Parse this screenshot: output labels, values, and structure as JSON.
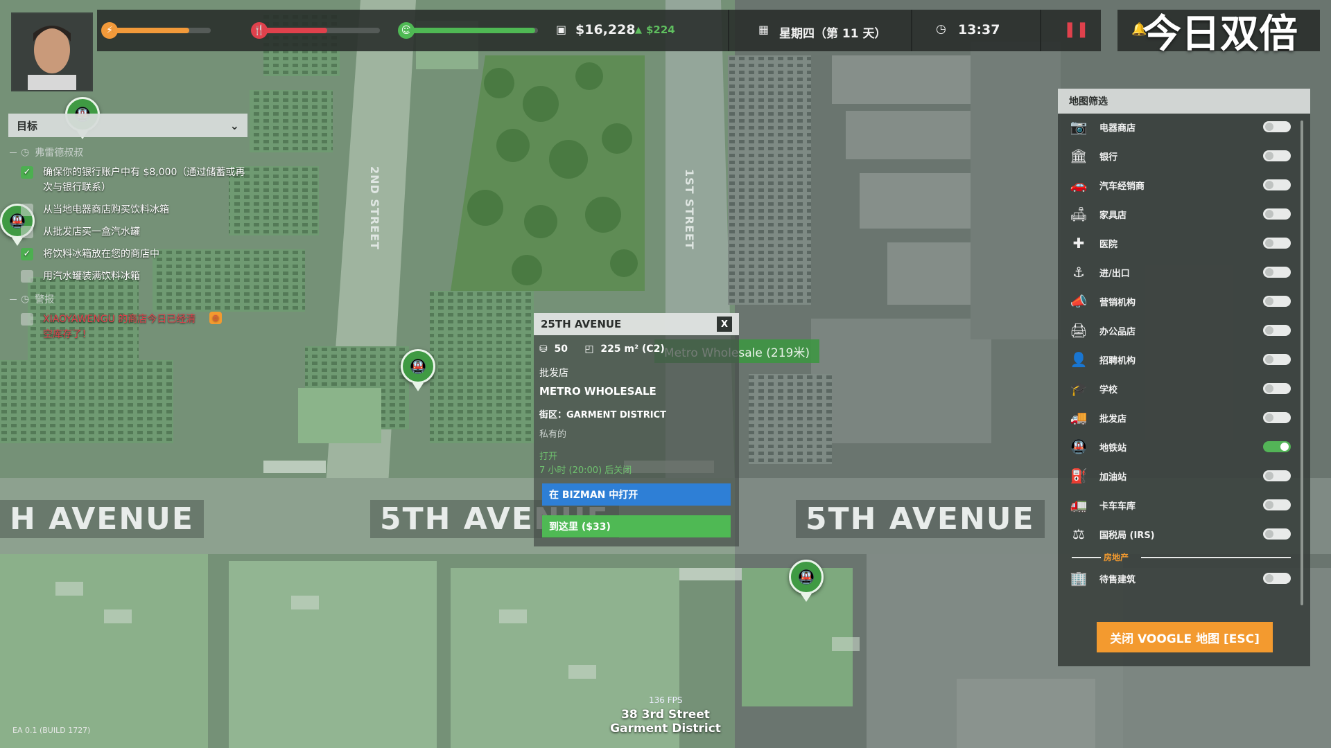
{
  "colors": {
    "energy": "#f29a3a",
    "hunger": "#e0414c",
    "happiness": "#4fb954",
    "accent_green": "#4caf50",
    "accent_blue": "#2e7fd6",
    "accent_orange": "#f39a2f",
    "alert_red": "#e0414c"
  },
  "hud": {
    "energy_level": 0.78,
    "hunger_level": 0.55,
    "happiness_level": 0.98,
    "money": "$16,228",
    "money_change": "$224",
    "day": "星期四（第 11 天）",
    "time": "13:37",
    "watermark": "今日双倍"
  },
  "goals": {
    "title": "目标",
    "sections": [
      {
        "name": "弗雷德叔叔",
        "items": [
          {
            "text": "确保你的银行账户中有 $8,000（通过储蓄或再次与银行联系）",
            "checked": true
          },
          {
            "text": "从当地电器商店购买饮料冰箱",
            "checked": false
          },
          {
            "text": "从批发店买一盒汽水罐",
            "checked": false
          },
          {
            "text": "将饮料冰箱放在您的商店中",
            "checked": true
          },
          {
            "text": "用汽水罐装满饮料冰箱",
            "checked": false
          }
        ]
      },
      {
        "name": "警报",
        "items": [
          {
            "text": "XIAOYAWENGU 的商店今日已经清空库存了！",
            "checked": false
          }
        ]
      }
    ]
  },
  "map": {
    "avenue_left": "H AVENUE",
    "avenue_mid": "5TH AVENUE",
    "avenue_right": "5TH AVENUE",
    "street_2nd": "2ND STREET",
    "street_1st": "1ST STREET"
  },
  "popup": {
    "title": "25TH AVENUE",
    "close": "X",
    "capacity": "50",
    "size": "225 m² (C2)",
    "category": "批发店",
    "name": "METRO WHOLESALE",
    "district": "街区：GARMENT DISTRICT",
    "ownership": "私有的",
    "status": "打开",
    "closing": "7 小时 (20:00) 后关闭",
    "btn_open": "在 BIZMAN 中打开",
    "btn_go": "到这里 ($33)"
  },
  "tooltip": "Metro Wholesale (219米)",
  "filter": {
    "title": "地图筛选",
    "items": [
      {
        "label": "电器商店",
        "icon": "appliance-store-icon",
        "glyph": "📷",
        "on": false
      },
      {
        "label": "银行",
        "icon": "bank-icon",
        "glyph": "🏛",
        "on": false
      },
      {
        "label": "汽车经销商",
        "icon": "car-dealer-icon",
        "glyph": "🚗",
        "on": false
      },
      {
        "label": "家具店",
        "icon": "furniture-store-icon",
        "glyph": "🛋",
        "on": false
      },
      {
        "label": "医院",
        "icon": "hospital-icon",
        "glyph": "✚",
        "on": false
      },
      {
        "label": "进/出口",
        "icon": "import-export-icon",
        "glyph": "⚓",
        "on": false
      },
      {
        "label": "营销机构",
        "icon": "marketing-agency-icon",
        "glyph": "📣",
        "on": false
      },
      {
        "label": "办公品店",
        "icon": "office-supply-icon",
        "glyph": "🖨",
        "on": false
      },
      {
        "label": "招聘机构",
        "icon": "recruitment-agency-icon",
        "glyph": "👤",
        "on": false
      },
      {
        "label": "学校",
        "icon": "school-icon",
        "glyph": "🎓",
        "on": false
      },
      {
        "label": "批发店",
        "icon": "wholesale-icon",
        "glyph": "🚚",
        "on": false
      },
      {
        "label": "地铁站",
        "icon": "subway-icon",
        "glyph": "🚇",
        "on": true
      },
      {
        "label": "加油站",
        "icon": "gas-station-icon",
        "glyph": "⛽",
        "on": false
      },
      {
        "label": "卡车车库",
        "icon": "truck-garage-icon",
        "glyph": "🚛",
        "on": false
      },
      {
        "label": "国税局 (IRS)",
        "icon": "irs-icon",
        "glyph": "⚖",
        "on": false
      }
    ],
    "section_real_estate": "房地产",
    "real_estate_items": [
      {
        "label": "待售建筑",
        "icon": "building-for-sale-icon",
        "glyph": "🏢",
        "on": false
      }
    ],
    "close_button": "关闭 VOOGLE 地图 [ESC]"
  },
  "footer": {
    "fps": "136 FPS",
    "address_line1": "38 3rd Street",
    "address_line2": "Garment District",
    "build": "EA 0.1 (BUILD 1727)"
  }
}
